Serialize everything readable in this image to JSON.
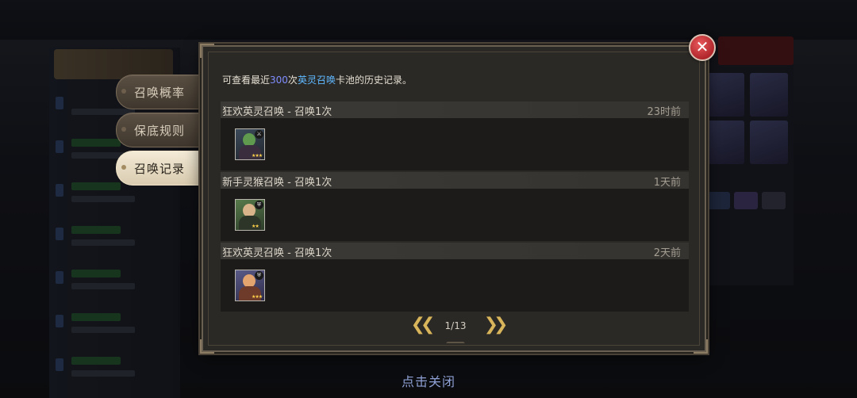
{
  "tabs": [
    {
      "label": "召唤概率",
      "active": false
    },
    {
      "label": "保底规则",
      "active": false
    },
    {
      "label": "召唤记录",
      "active": true
    }
  ],
  "description": {
    "prefix": "可查看最近",
    "count": "300",
    "mid": "次",
    "pool": "英灵召唤",
    "suffix": "卡池的历史记录。"
  },
  "records": [
    {
      "name": "狂欢英灵召唤 - 召唤1次",
      "time": "23时前",
      "badge_icon": "crossed-swords-icon",
      "stars": "★★★"
    },
    {
      "name": "新手灵猴召唤 - 召唤1次",
      "time": "1天前",
      "badge_icon": "shield-icon",
      "stars": "★★"
    },
    {
      "name": "狂欢英灵召唤 - 召唤1次",
      "time": "2天前",
      "badge_icon": "shield-icon",
      "stars": "★★★"
    }
  ],
  "pager": {
    "page": "1/13",
    "prev_icon": "double-chevron-left-icon",
    "next_icon": "double-chevron-right-icon"
  },
  "close": {
    "icon": "close-icon",
    "glyph": "✕"
  },
  "footer": {
    "tap_close": "点击关闭"
  },
  "colors": {
    "accent_count": "#7f8dff",
    "accent_pool": "#5fb8ff",
    "close_red": "#c0323a",
    "arrow_gold": "#d8b45a"
  }
}
